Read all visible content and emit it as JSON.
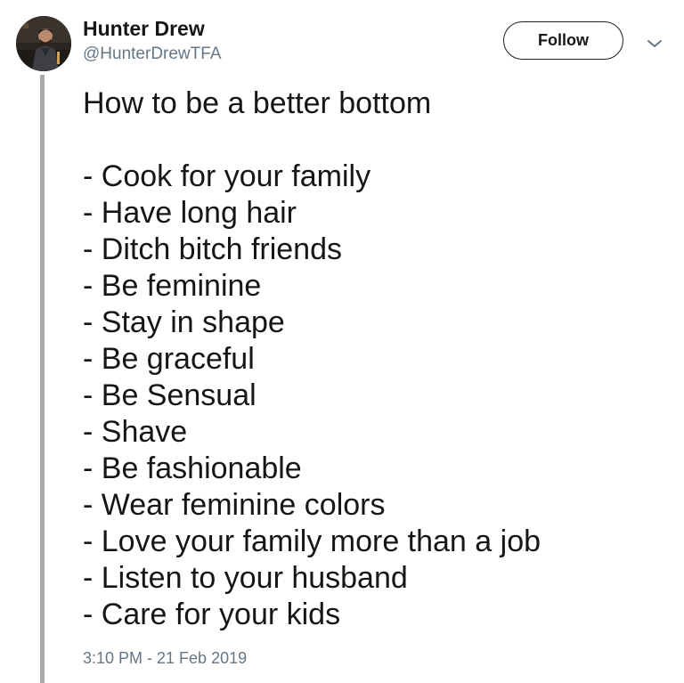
{
  "author": {
    "name": "Hunter Drew",
    "handle": "@HunterDrewTFA"
  },
  "actions": {
    "follow_label": "Follow",
    "menu_icon": "chevron-down-icon"
  },
  "tweet": {
    "title": "How to be a better bottom",
    "items": [
      "- Cook for your family",
      "- Have long hair",
      "- Ditch bitch friends",
      "- Be feminine",
      "- Stay in shape",
      "- Be graceful",
      "- Be Sensual",
      "- Shave",
      "- Be fashionable",
      "- Wear feminine colors",
      "- Love your family more than a job",
      "- Listen to your husband",
      "- Care for your kids"
    ],
    "timestamp": "3:10 PM - 21 Feb 2019"
  },
  "colors": {
    "text": "#14171a",
    "secondary_text": "#657786",
    "thread_line": "#a6a9ad",
    "button_border": "#1c1e21"
  }
}
